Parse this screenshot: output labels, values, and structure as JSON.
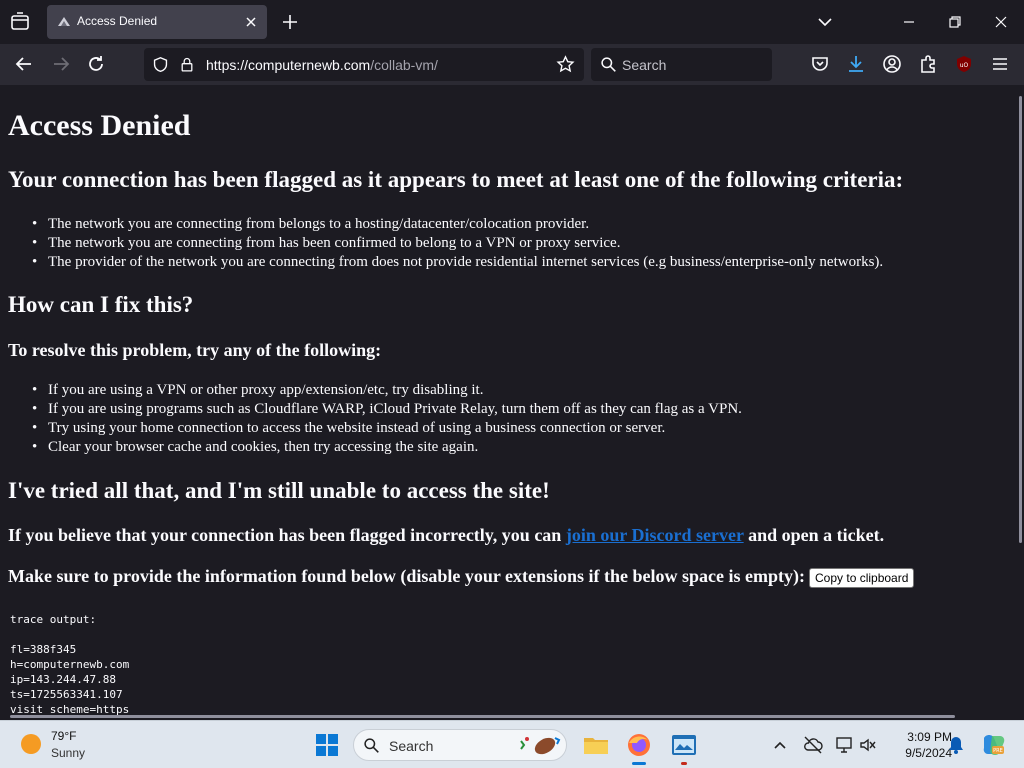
{
  "browser": {
    "tab_title": "Access Denied",
    "url_domain": "https://computernewb.com",
    "url_path": "/collab-vm/",
    "search_placeholder": "Search"
  },
  "page": {
    "h1": "Access Denied",
    "criteria_heading": "Your connection has been flagged as it appears to meet at least one of the following criteria:",
    "criteria": [
      "The network you are connecting from belongs to a hosting/datacenter/colocation provider.",
      "The network you are connecting from has been confirmed to belong to a VPN or proxy service.",
      "The provider of the network you are connecting from does not provide residential internet services (e.g business/enterprise-only networks)."
    ],
    "fix_heading": "How can I fix this?",
    "resolve_heading": "To resolve this problem, try any of the following:",
    "fixes": [
      "If you are using a VPN or other proxy app/extension/etc, try disabling it.",
      "If you are using programs such as Cloudflare WARP, iCloud Private Relay, turn them off as they can flag as a VPN.",
      "Try using your home connection to access the website instead of using a business connection or server.",
      "Clear your browser cache and cookies, then try accessing the site again."
    ],
    "tried_heading": "I've tried all that, and I'm still unable to access the site!",
    "discord_pre": "If you believe that your connection has been flagged incorrectly, you can ",
    "discord_link": "join our Discord server",
    "discord_post": " and open a ticket.",
    "provide_text": "Make sure to provide the information found below (disable your extensions if the below space is empty):",
    "copy_button": "Copy to clipboard",
    "trace_label": "trace output:",
    "trace_lines": [
      "fl=388f345",
      "h=computernewb.com",
      "ip=143.244.47.88",
      "ts=1725563341.107",
      "visit_scheme=https"
    ]
  },
  "taskbar": {
    "temp": "79°F",
    "condition": "Sunny",
    "search_label": "Search",
    "time": "3:09 PM",
    "date": "9/5/2024"
  }
}
